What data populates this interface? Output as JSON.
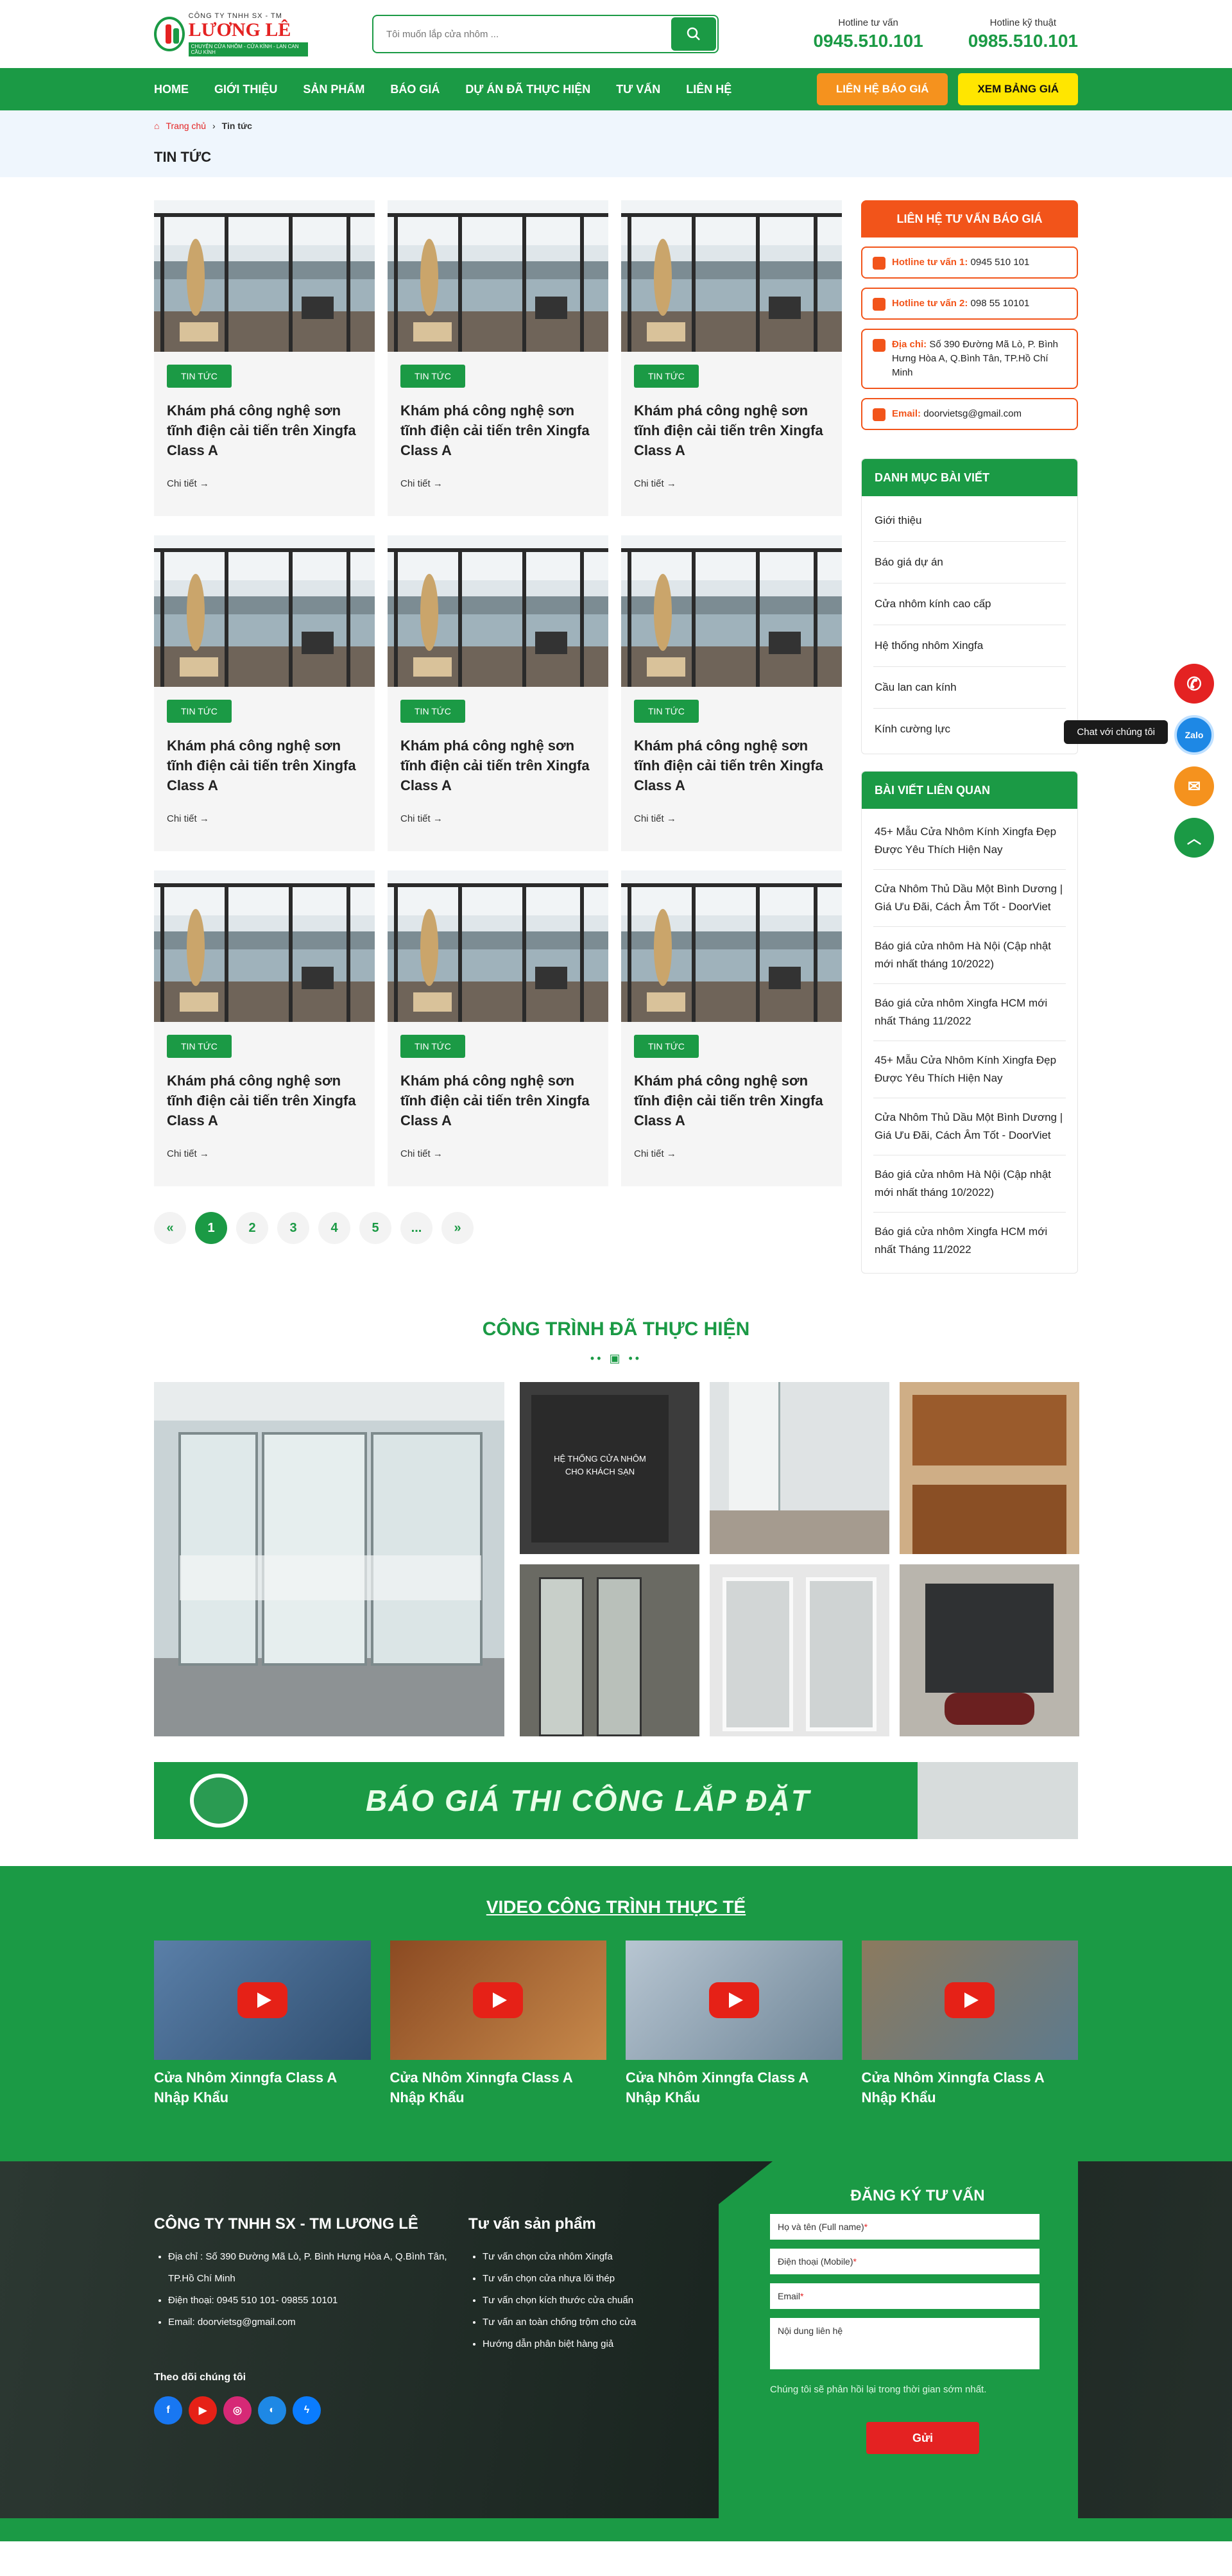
{
  "header": {
    "logo_small": "CÔNG TY TNHH SX - TM",
    "logo_big": "LƯƠNG LÊ",
    "logo_tag": "CHUYÊN CỬA NHÔM - CỬA KÍNH - LAN CAN CẦU KÍNH",
    "search_placeholder": "Tôi muốn lắp cửa nhôm ...",
    "hotline1_label": "Hotline tư vấn",
    "hotline1_number": "0945.510.101",
    "hotline2_label": "Hotline kỹ thuật",
    "hotline2_number": "0985.510.101"
  },
  "nav": {
    "items": [
      "HOME",
      "GIỚI THIỆU",
      "SẢN PHẨM",
      "BÁO GIÁ",
      "DỰ ÁN ĐÃ THỰC HIỆN",
      "TƯ VẤN",
      "LIÊN HỆ"
    ],
    "quote_button": "LIÊN HỆ BÁO GIÁ",
    "price_button": "XEM BẢNG GIÁ"
  },
  "breadcrumb": {
    "home": "Trang chủ",
    "current": "Tin tức"
  },
  "page_title": "TIN TỨC",
  "cards": [
    {
      "tag": "TIN TỨC",
      "title": "Khám phá công nghệ sơn tĩnh điện cải tiến trên Xingfa Class A",
      "more": "Chi tiết"
    },
    {
      "tag": "TIN TỨC",
      "title": "Khám phá công nghệ sơn tĩnh điện cải tiến trên Xingfa Class A",
      "more": "Chi tiết"
    },
    {
      "tag": "TIN TỨC",
      "title": "Khám phá công nghệ sơn tĩnh điện cải tiến trên Xingfa Class A",
      "more": "Chi tiết"
    },
    {
      "tag": "TIN TỨC",
      "title": "Khám phá công nghệ sơn tĩnh điện cải tiến trên Xingfa Class A",
      "more": "Chi tiết"
    },
    {
      "tag": "TIN TỨC",
      "title": "Khám phá công nghệ sơn tĩnh điện cải tiến trên Xingfa Class A",
      "more": "Chi tiết"
    },
    {
      "tag": "TIN TỨC",
      "title": "Khám phá công nghệ sơn tĩnh điện cải tiến trên Xingfa Class A",
      "more": "Chi tiết"
    },
    {
      "tag": "TIN TỨC",
      "title": "Khám phá công nghệ sơn tĩnh điện cải tiến trên Xingfa Class A",
      "more": "Chi tiết"
    },
    {
      "tag": "TIN TỨC",
      "title": "Khám phá công nghệ sơn tĩnh điện cải tiến trên Xingfa Class A",
      "more": "Chi tiết"
    },
    {
      "tag": "TIN TỨC",
      "title": "Khám phá công nghệ sơn tĩnh điện cải tiến trên Xingfa Class A",
      "more": "Chi tiết"
    }
  ],
  "pagination": [
    "«",
    "1",
    "2",
    "3",
    "4",
    "5",
    "...",
    "»"
  ],
  "pagination_active": "1",
  "sidebar": {
    "contact_title": "LIÊN HỆ TƯ VẤN BÁO GIÁ",
    "contacts": [
      {
        "key": "Hotline tư vấn 1:",
        "value": "0945 510 101"
      },
      {
        "key": "Hotline tư vấn 2:",
        "value": "098 55 10101"
      },
      {
        "key": "Địa chỉ:",
        "value": "Số 390 Đường Mã Lò, P. Bình Hưng Hòa A, Q.Bình Tân, TP.Hồ Chí Minh"
      },
      {
        "key": "Email:",
        "value": "doorvietsg@gmail.com"
      }
    ],
    "categories_title": "DANH MỤC BÀI VIẾT",
    "categories": [
      "Giới thiệu",
      "Báo giá dự án",
      "Cửa nhôm kính cao cấp",
      "Hệ thống nhôm Xingfa",
      "Cầu lan can kính",
      "Kính cường lực"
    ],
    "related_title": "BÀI  VIẾT LIÊN QUAN",
    "related": [
      "45+ Mẫu Cửa Nhôm Kính Xingfa Đẹp Được Yêu Thích Hiện Nay",
      "Cửa Nhôm Thủ Dầu Một Bình Dương | Giá Ưu Đãi, Cách Âm Tốt - DoorViet",
      "Báo giá cửa nhôm Hà Nội (Cập nhật mới nhất tháng 10/2022)",
      "Báo giá cửa nhôm Xingfa HCM mới nhất Tháng 11/2022",
      "45+ Mẫu Cửa Nhôm Kính Xingfa Đẹp Được Yêu Thích Hiện Nay",
      "Cửa Nhôm Thủ Dầu Một Bình Dương | Giá Ưu Đãi, Cách Âm Tốt - DoorViet",
      "Báo giá cửa nhôm Hà Nội (Cập nhật mới nhất tháng 10/2022)",
      "Báo giá cửa nhôm Xingfa HCM mới nhất Tháng 11/2022"
    ]
  },
  "projects": {
    "title": "CÔNG TRÌNH ĐÃ THỰC HIỆN",
    "overlay_label": "HỆ THỐNG CỬA NHÔM CHO KHÁCH SẠN"
  },
  "banner_text": "BÁO GIÁ THI CÔNG LẮP ĐẶT",
  "videos": {
    "title": "VIDEO CÔNG TRÌNH THỰC TẾ",
    "items": [
      "Cửa Nhôm Xinngfa Class A Nhập Khẩu",
      "Cửa Nhôm Xinngfa Class A Nhập Khẩu",
      "Cửa Nhôm Xinngfa Class A Nhập Khẩu",
      "Cửa Nhôm Xinngfa Class A Nhập Khẩu"
    ]
  },
  "footer": {
    "company": "CÔNG TY TNHH SX - TM LƯƠNG LÊ",
    "address": "Địa chỉ : Số 390 Đường Mã Lò, P. Bình Hưng Hòa A, Q.Bình Tân, TP.Hồ Chí Minh",
    "phone": "Điện thoại: 0945 510 101- 09855 10101",
    "email": "Email: doorvietsg@gmail.com",
    "follow": "Theo dõi chúng tôi",
    "col2_title": "Tư vấn sản phẩm",
    "col2_items": [
      "Tư vấn chọn cửa nhôm Xingfa",
      "Tư vấn chọn cửa nhựa lõi thép",
      "Tư vấn chọn kích thước cửa chuẩn",
      "Tư vấn an toàn chống trộm cho cửa",
      "Hướng dẫn phân biệt hàng giả"
    ],
    "form_title": "ĐĂNG KÝ TƯ VẤN",
    "field_name": "Họ và tên (Full name)",
    "field_phone": "Điện thoại (Mobile)",
    "field_email": "Email",
    "field_content": "Nội dung liên hệ",
    "note": "Chúng tôi sẽ phản hồi lại trong thời gian sớm nhất.",
    "send": "Gửi"
  },
  "floating": {
    "chat_label": "Chat với chúng tôi",
    "zalo": "Zalo"
  },
  "colors": {
    "brand_green": "#1b9a45",
    "accent_orange": "#f2541a",
    "accent_yellow": "#ffe600",
    "accent_red": "#e42222"
  }
}
